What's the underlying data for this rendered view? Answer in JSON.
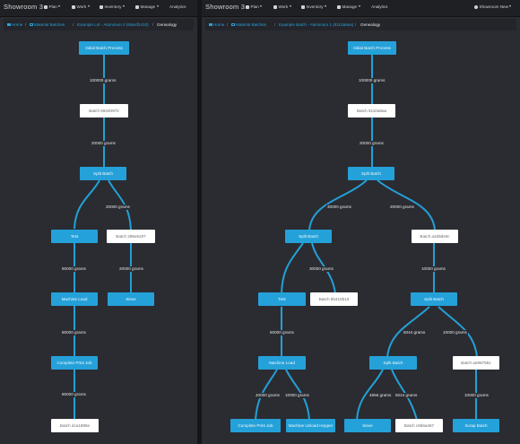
{
  "left": {
    "brand": "Showroom 3",
    "menu": {
      "plan": "Plan",
      "work": "Work",
      "inventory": "Inventory",
      "manage": "Manage",
      "analytics": "Analytics"
    },
    "breadcrumb": {
      "home": "Home",
      "material_batches": "Material Batches",
      "lot": "Example Lot - Aluminum 2 (66e4f2410)",
      "current": "Genealogy"
    },
    "nodes": {
      "initial": "Initial Batch Process",
      "batch1": "Batch 69440972",
      "split": "Split Batch",
      "test": "Test",
      "batch2": "Batch 295e5207",
      "machine_load": "Machine Load",
      "sieve": "Sieve",
      "complete": "Complete Print Job",
      "batch3": "Batch dca1898e"
    },
    "edges": {
      "e1": "100000 grams",
      "e2": "20000 grams",
      "e3": "20000 grams",
      "e4": "80000 grams",
      "e5": "20000 grams",
      "e6": "80000 grams",
      "e7": "80000 grams"
    }
  },
  "right": {
    "brand": "Showroom 3",
    "menu": {
      "plan": "Plan",
      "work": "Work",
      "inventory": "Inventory",
      "manage": "Manage",
      "analytics": "Analytics",
      "user": "Showroom New"
    },
    "breadcrumb": {
      "home": "Home",
      "material_batches": "Material Batches",
      "lot": "Example Batch - Aluminum 1 (6110a8aa)",
      "current": "Genealogy"
    },
    "nodes": {
      "initial": "Initial Batch Process",
      "batch1": "Batch 6110a8aa",
      "split1": "Split Batch",
      "split2": "Split Batch",
      "batch2": "Batch a2d9de0c",
      "test": "Test",
      "batch3": "Batch 5b410b13",
      "split3": "Split Batch",
      "machine_load": "Machine Load",
      "split4": "Split Batch",
      "batch4": "Batch ae997551",
      "complete": "Complete Print Job",
      "unload": "Machine Unload Hopper",
      "sieve": "Sieve",
      "batch5": "Batch c666a467",
      "scrap": "Scrap Batch"
    },
    "edges": {
      "e1": "100000 grams",
      "e2": "20000 grams",
      "e3": "30000 grams",
      "e4": "20000 grams",
      "e5": "30000 grams",
      "e6": "10000 grams",
      "e7": "50000 grams",
      "e8": "5044 grams",
      "e9": "10000 grams",
      "e10": "40000 grams",
      "e11": "10000 grams",
      "e12": "4956 grams",
      "e13": "5044 grams",
      "e14": "10000 grams"
    }
  },
  "colors": {
    "node_blue": "#25a1d9",
    "node_white": "#ffffff",
    "link": "#2b9fd6",
    "edge": "#24a0d6",
    "background": "#2a2c32"
  }
}
